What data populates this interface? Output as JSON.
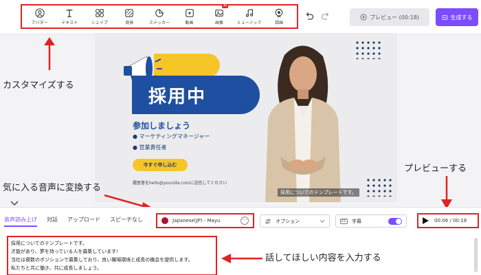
{
  "toolbar": {
    "tools": [
      {
        "label": "アバター",
        "icon": "avatar-icon"
      },
      {
        "label": "テキスト",
        "icon": "text-icon"
      },
      {
        "label": "シェイプ",
        "icon": "shape-icon"
      },
      {
        "label": "背景",
        "icon": "background-icon"
      },
      {
        "label": "ステッカー",
        "icon": "sticker-icon"
      },
      {
        "label": "動画",
        "icon": "video-icon"
      },
      {
        "label": "画像",
        "icon": "image-icon",
        "badge": "AI"
      },
      {
        "label": "ミュージック",
        "icon": "music-icon"
      },
      {
        "label": "録画",
        "icon": "record-icon"
      }
    ],
    "preview_label": "プレビュー (00:18)",
    "generate_label": "生成する"
  },
  "annotations": {
    "customize": "カスタマイズする",
    "voice": "気に入る音声に変換する",
    "preview": "プレビューする",
    "text": "話してほしい内容を入力する"
  },
  "slide": {
    "banner": "採用中",
    "join": "参加しましょう",
    "bullets": [
      "● マーケティングマネージャー",
      "● 営業責任者"
    ],
    "apply_label": "今すぐ申し込む",
    "email": "履歴書をhello@yoursite.comに送信してください",
    "subtitle": "採用についてのテンプレートです。"
  },
  "editor": {
    "tabs": [
      "音声読み上げ",
      "対話",
      "アップロード",
      "スピーチなし"
    ],
    "active_tab": 0,
    "voice": "Japanese(JP) - Mayu",
    "more_symbol": "···",
    "option_label": "オプション",
    "cc_label": "CC",
    "subtitle_label": "字幕",
    "time": "00:06 / 00:18",
    "script_lines": [
      "採用についてのテンプレートです。",
      "才能があり、夢を持っている人を募集しています!",
      "当社は複数のポジションで募集しており、良い職場環境と成長の機会を提供します。",
      "私たちと共に働き、共に成長しましょう。"
    ]
  },
  "colors": {
    "accent": "#7b4dff",
    "highlight": "#e02222",
    "slide_blue": "#1e4fa0",
    "slide_yellow": "#f6c629"
  }
}
